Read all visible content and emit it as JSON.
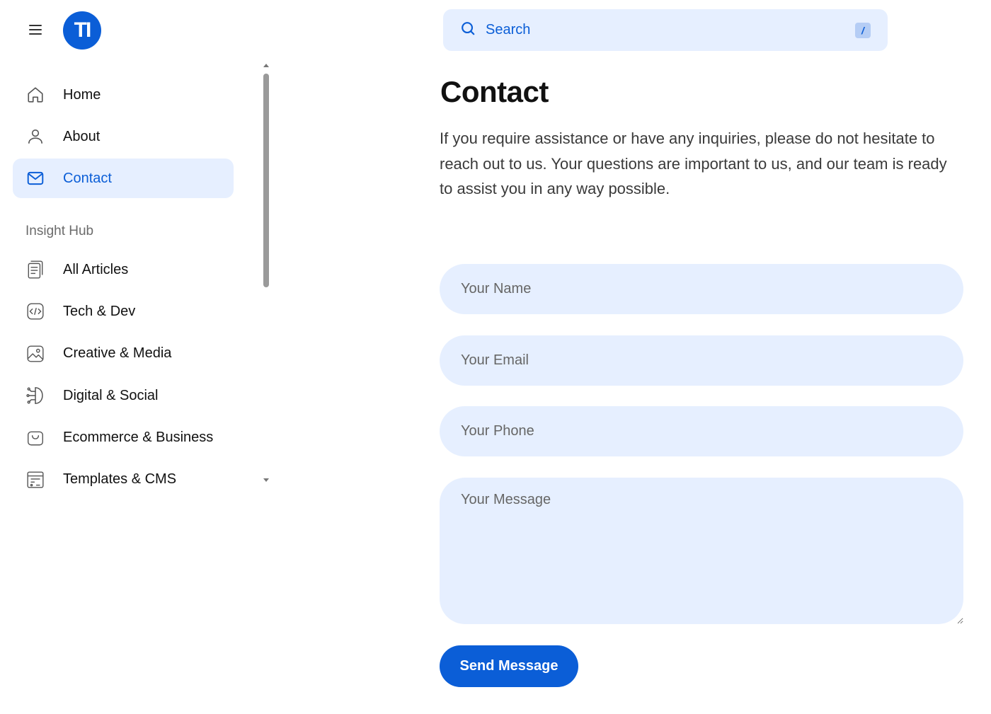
{
  "header": {
    "logo_text": "TI",
    "search": {
      "label": "Search",
      "shortcut": "/"
    }
  },
  "sidebar": {
    "main_items": [
      {
        "label": "Home",
        "icon": "home-icon",
        "active": false
      },
      {
        "label": "About",
        "icon": "user-icon",
        "active": false
      },
      {
        "label": "Contact",
        "icon": "mail-icon",
        "active": true
      }
    ],
    "section_title": "Insight Hub",
    "hub_items": [
      {
        "label": "All Articles",
        "icon": "articles-icon"
      },
      {
        "label": "Tech & Dev",
        "icon": "code-icon"
      },
      {
        "label": "Creative & Media",
        "icon": "image-icon"
      },
      {
        "label": "Digital & Social",
        "icon": "network-icon"
      },
      {
        "label": "Ecommerce & Business",
        "icon": "bag-icon"
      },
      {
        "label": "Templates & CMS",
        "icon": "template-icon"
      }
    ]
  },
  "main": {
    "title": "Contact",
    "description": "If you require assistance or have any inquiries, please do not hesitate to reach out to us. Your questions are important to us, and our team is ready to assist you in any way possible.",
    "form": {
      "name_placeholder": "Your Name",
      "email_placeholder": "Your Email",
      "phone_placeholder": "Your Phone",
      "message_placeholder": "Your Message",
      "submit_label": "Send Message"
    }
  },
  "colors": {
    "accent": "#0b5ed7",
    "accent_light": "#e6efff",
    "text": "#111111",
    "muted": "#6b6b6b"
  }
}
